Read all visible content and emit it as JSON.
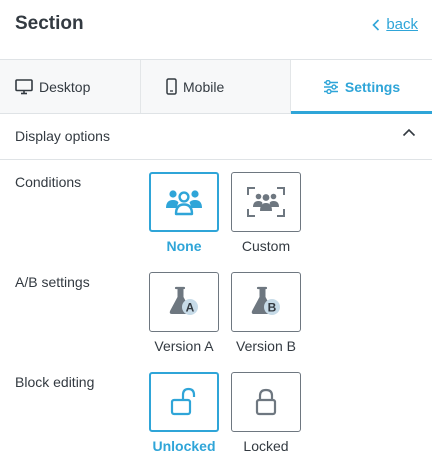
{
  "header": {
    "title": "Section",
    "back_label": "back"
  },
  "tabs": [
    {
      "label": "Desktop",
      "icon": "desktop-icon"
    },
    {
      "label": "Mobile",
      "icon": "mobile-icon"
    },
    {
      "label": "Settings",
      "icon": "sliders-icon",
      "selected": true
    }
  ],
  "panel": {
    "title": "Display options",
    "expanded": true
  },
  "rows": {
    "conditions": {
      "label": "Conditions",
      "options": [
        {
          "label": "None",
          "icon": "group-icon",
          "selected": true
        },
        {
          "label": "Custom",
          "icon": "group-targeted-icon",
          "selected": false
        }
      ]
    },
    "ab": {
      "label": "A/B settings",
      "options": [
        {
          "label": "Version A",
          "icon": "flask-a-icon",
          "selected": false
        },
        {
          "label": "Version B",
          "icon": "flask-b-icon",
          "selected": false
        }
      ]
    },
    "block_editing": {
      "label": "Block editing",
      "options": [
        {
          "label": "Unlocked",
          "icon": "unlock-icon",
          "selected": true
        },
        {
          "label": "Locked",
          "icon": "lock-icon",
          "selected": false
        }
      ]
    }
  },
  "colors": {
    "accent": "#2fa5d8",
    "text": "#333a41",
    "icon_gray": "#6e7780",
    "badge": "#c7dbe8"
  }
}
